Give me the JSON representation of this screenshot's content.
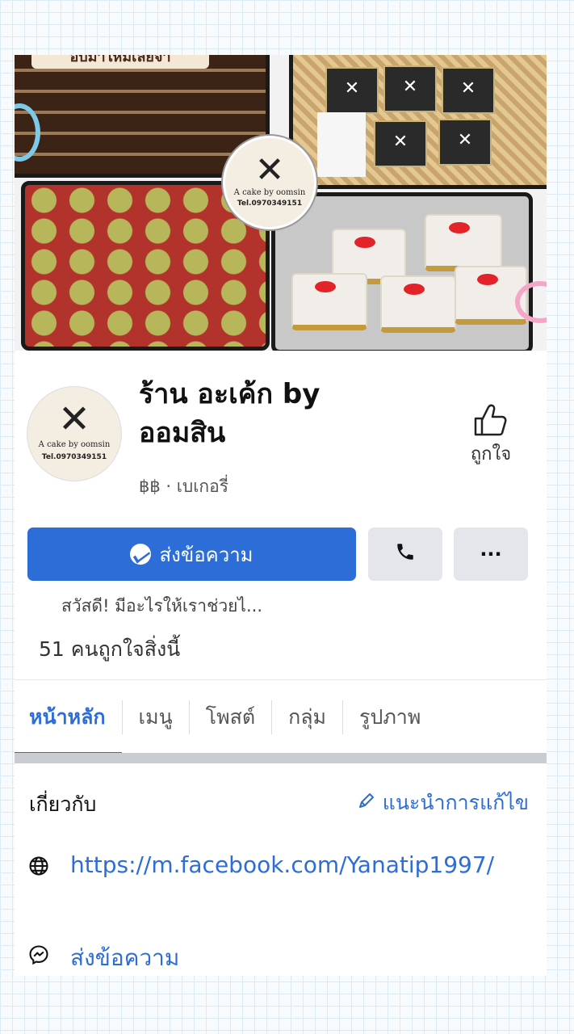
{
  "cover": {
    "banner_text": "อบมาใหม่เลยจ้า",
    "logo_line1": "A cake by oomsin",
    "logo_line2": "Tel.0970349151"
  },
  "profile": {
    "name": "ร้าน อะเค้ก by ออมสิน",
    "category": "฿฿ · เบเกอรี่",
    "avatar_line1": "A cake by oomsin",
    "avatar_line2": "Tel.0970349151",
    "like_label": "ถูกใจ"
  },
  "actions": {
    "message_label": "ส่งข้อความ",
    "call_icon": "phone-icon",
    "more_label": "···",
    "greeting": "สวัสดี! มีอะไรให้เราช่วยไ..."
  },
  "stats": {
    "likes_text": "51 คนถูกใจสิ่งนี้"
  },
  "tabs": [
    {
      "label": "หน้าหลัก",
      "active": true
    },
    {
      "label": "เมนู"
    },
    {
      "label": "โพสต์"
    },
    {
      "label": "กลุ่ม"
    },
    {
      "label": "รูปภาพ"
    }
  ],
  "about": {
    "title": "เกี่ยวกับ",
    "suggest_edit": "แนะนำการแก้ไข",
    "website": "https://m.facebook.com/Yanatip1997/",
    "send_message": "ส่งข้อความ"
  },
  "colors": {
    "accent": "#2d6dd8",
    "button_gray": "#e4e6eb"
  }
}
